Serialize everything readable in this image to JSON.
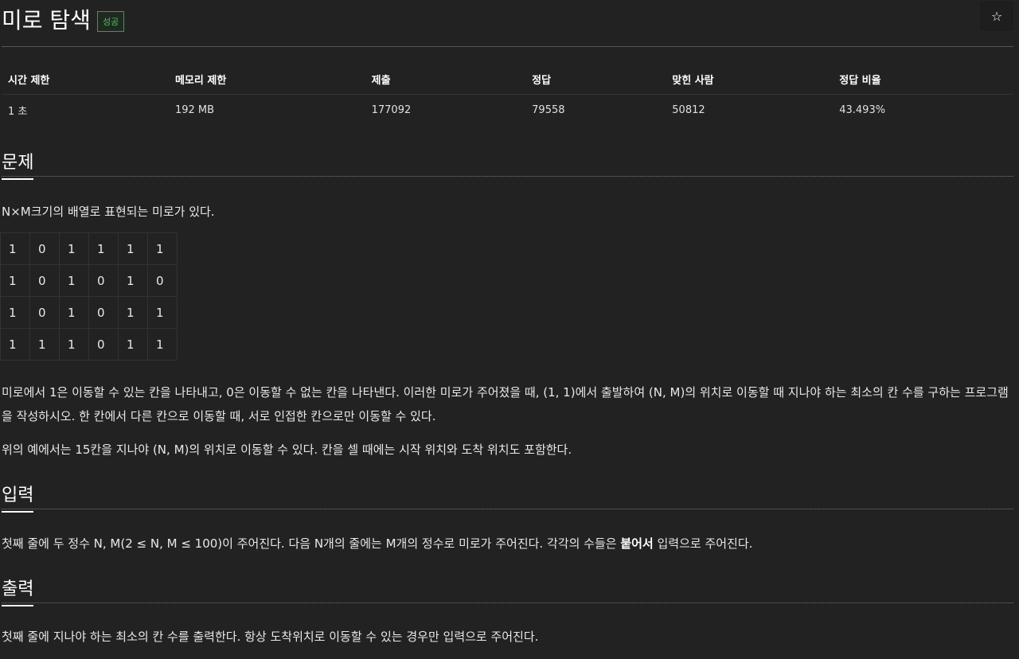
{
  "header": {
    "title": "미로 탐색",
    "badge": "성공",
    "star_icon": "star-icon"
  },
  "info_table": {
    "headers": [
      "시간 제한",
      "메모리 제한",
      "제출",
      "정답",
      "맞힌 사람",
      "정답 비율"
    ],
    "values": [
      "1 초",
      "192 MB",
      "177092",
      "79558",
      "50812",
      "43.493%"
    ]
  },
  "problem": {
    "heading": "문제",
    "intro": "N×M크기의 배열로 표현되는 미로가 있다.",
    "maze": [
      [
        "1",
        "0",
        "1",
        "1",
        "1",
        "1"
      ],
      [
        "1",
        "0",
        "1",
        "0",
        "1",
        "0"
      ],
      [
        "1",
        "0",
        "1",
        "0",
        "1",
        "1"
      ],
      [
        "1",
        "1",
        "1",
        "0",
        "1",
        "1"
      ]
    ],
    "para1": "미로에서 1은 이동할 수 있는 칸을 나타내고, 0은 이동할 수 없는 칸을 나타낸다. 이러한 미로가 주어졌을 때, (1, 1)에서 출발하여 (N, M)의 위치로 이동할 때 지나야 하는 최소의 칸 수를 구하는 프로그램을 작성하시오. 한 칸에서 다른 칸으로 이동할 때, 서로 인접한 칸으로만 이동할 수 있다.",
    "para2": "위의 예에서는 15칸을 지나야 (N, M)의 위치로 이동할 수 있다. 칸을 셀 때에는 시작 위치와 도착 위치도 포함한다."
  },
  "input": {
    "heading": "입력",
    "text_before": "첫째 줄에 두 정수 N, M(2 ≤ N, M ≤ 100)이 주어진다. 다음 N개의 줄에는 M개의 정수로 미로가 주어진다. 각각의 수들은 ",
    "bold": "붙어서",
    "text_after": " 입력으로 주어진다."
  },
  "output": {
    "heading": "출력",
    "text": "첫째 줄에 지나야 하는 최소의 칸 수를 출력한다. 항상 도착위치로 이동할 수 있는 경우만 입력으로 주어진다."
  }
}
